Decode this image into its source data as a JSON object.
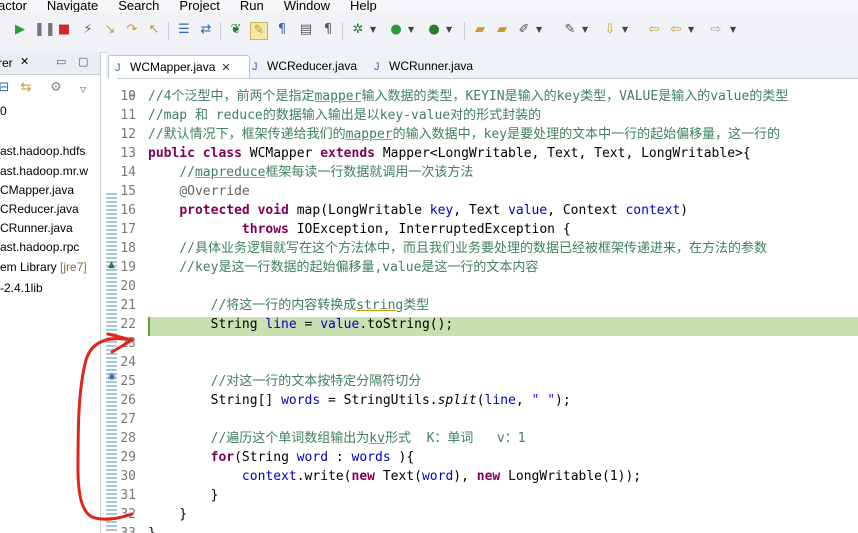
{
  "menu": [
    "actor",
    "Navigate",
    "Search",
    "Project",
    "Run",
    "Window",
    "Help"
  ],
  "left_panel": {
    "tab_title": "rer",
    "row_label": "0",
    "items": [
      {
        "text": "ast.hadoop.hdfs"
      },
      {
        "text": "ast.hadoop.mr.w"
      },
      {
        "text": "CMapper.java"
      },
      {
        "text": "CReducer.java"
      },
      {
        "text": "CRunner.java"
      },
      {
        "text": "ast.hadoop.rpc"
      },
      {
        "text": "em Library ",
        "dec": "[jre7]"
      },
      {
        "text": "-2.4.1lib"
      }
    ]
  },
  "editor": {
    "tabs": [
      {
        "label": "WCMapper.java",
        "active": true,
        "close": "✕"
      },
      {
        "label": "WCReducer.java",
        "active": false
      },
      {
        "label": "WCRunner.java",
        "active": false
      }
    ],
    "top_line_stub": "9",
    "highlighted_line": "22",
    "lines": [
      {
        "n": "10",
        "html": "<span class='cm'>//4个泛型中，前两个是指定<span class='ul'>mapper</span>输入数据的类型，KEYIN是输入的key类型，VALUE是输入的value的类型</span>"
      },
      {
        "n": "11",
        "html": "<span class='cm'>//map 和 reduce的数据输入输出是以key-value对的形式封装的</span>"
      },
      {
        "n": "12",
        "html": "<span class='cm'>//默认情况下，框架传递给我们的<span class='ul'>mapper</span>的输入数据中，key是要处理的文本中一行的起始偏移量，这一行的</span>"
      },
      {
        "n": "13",
        "html": "<span class='kw'>public class</span> WCMapper <span class='kw'>extends</span> Mapper&lt;LongWritable, Text, Text, LongWritable&gt;{"
      },
      {
        "n": "14",
        "html": "    <span class='cm'>//<span class='ul'>mapreduce</span>框架每读一行数据就调用一次该方法</span>"
      },
      {
        "n": "15",
        "html": "    <span class='an'>@Override</span>"
      },
      {
        "n": "16",
        "html": "    <span class='kw'>protected void</span> map(LongWritable <span class='fd'>key</span>, Text <span class='fd'>value</span>, Context <span class='fd'>context</span>)"
      },
      {
        "n": "17",
        "html": "            <span class='kw'>throws</span> IOException, InterruptedException {"
      },
      {
        "n": "18",
        "html": "    <span class='cm'>//具体业务逻辑就写在这个方法体中，而且我们业务要处理的数据已经被框架传递进来，在方法的参数</span>"
      },
      {
        "n": "19",
        "html": "    <span class='cm'>//key是这一行数据的起始偏移量,value是这一行的文本内容</span>"
      },
      {
        "n": "20",
        "html": ""
      },
      {
        "n": "21",
        "html": "        <span class='cm'>//将这一行的内容转换成<span class='ul'>string</span>类型</span>"
      },
      {
        "n": "22",
        "html": "        String <span class='fd'>line</span> = <span class='fd'>value</span>.toString();"
      },
      {
        "n": "23",
        "html": ""
      },
      {
        "n": "24",
        "html": ""
      },
      {
        "n": "25",
        "html": "        <span class='cm'>//对这一行的文本按特定分隔符切分</span>"
      },
      {
        "n": "26",
        "html": "        String[] <span class='fd'>words</span> = StringUtils.<span class='it'>split</span>(<span class='fd'>line</span>, <span class='st'>\" \"</span>);"
      },
      {
        "n": "27",
        "html": ""
      },
      {
        "n": "28",
        "html": "        <span class='cm'>//遍历这个单词数组输出为<span class='ul'>kv</span>形式  K：单词   v：1</span>"
      },
      {
        "n": "29",
        "html": "        <span class='kw'>for</span>(String <span class='fd'>word</span> : <span class='fd'>words</span> ){"
      },
      {
        "n": "30",
        "html": "            <span class='fd'>context</span>.write(<span class='kw'>new</span> Text(<span class='fd'>word</span>), <span class='kw'>new</span> LongWritable(1));"
      },
      {
        "n": "31",
        "html": "        }"
      },
      {
        "n": "32",
        "html": "    }"
      },
      {
        "n": "33",
        "html": "}"
      }
    ]
  },
  "colors": {
    "comment": "#3f7f5f",
    "keyword": "#7f0055",
    "field": "#0000c0",
    "string": "#2a00ff",
    "current_line": "#c9e0b1",
    "annotation_stroke": "#e0251b"
  },
  "icons": [
    "run-icon",
    "debug-icon",
    "stop-icon",
    "save-icon",
    "search-icon",
    "gear-icon"
  ]
}
